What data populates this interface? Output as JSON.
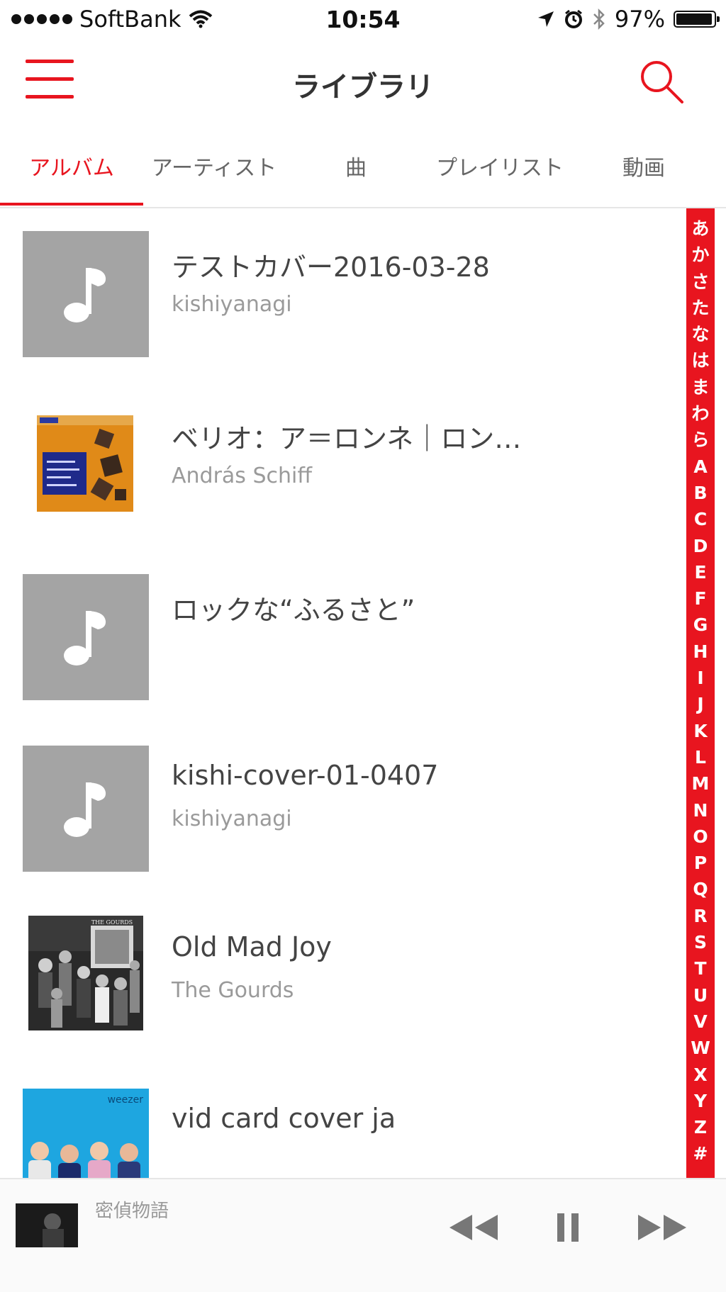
{
  "status_bar": {
    "carrier": "SoftBank",
    "time": "10:54",
    "battery": "97%",
    "battery_level": 0.97,
    "icons": [
      "signal-dots-icon",
      "wifi-icon",
      "location-icon",
      "alarm-icon",
      "bluetooth-icon",
      "battery-icon"
    ]
  },
  "header": {
    "title": "ライブラリ",
    "menu_icon": "hamburger-menu-icon",
    "search_icon": "search-icon",
    "accent": "#e8151f"
  },
  "tabs": [
    {
      "label": "アルバム",
      "active": true
    },
    {
      "label": "アーティスト",
      "active": false
    },
    {
      "label": "曲",
      "active": false
    },
    {
      "label": "プレイリスト",
      "active": false
    },
    {
      "label": "動画",
      "active": false
    }
  ],
  "albums": [
    {
      "title": "テストカバー2016-03-28",
      "artist": "kishiyanagi",
      "cover": "music-note-placeholder"
    },
    {
      "title": "ベリオ：ア＝ロンネ｜ロン…",
      "artist": "András Schiff",
      "cover": "orange-album-art"
    },
    {
      "title": "ロックな“ふるさと”",
      "artist": "",
      "cover": "music-note-placeholder"
    },
    {
      "title": "kishi-cover-01-0407",
      "artist": "kishiyanagi",
      "cover": "music-note-placeholder"
    },
    {
      "title": "Old Mad Joy",
      "artist": "The Gourds",
      "cover": "bw-photo-album-art",
      "cover_text": "THE GOURDS"
    },
    {
      "title": "vid card cover ja",
      "artist": "",
      "cover": "blue-band-photo-album-art",
      "cover_text": "weezer"
    }
  ],
  "index": [
    "あ",
    "か",
    "さ",
    "た",
    "な",
    "は",
    "ま",
    "わ",
    "ら",
    "A",
    "B",
    "C",
    "D",
    "E",
    "F",
    "G",
    "H",
    "I",
    "J",
    "K",
    "L",
    "M",
    "N",
    "O",
    "P",
    "Q",
    "R",
    "S",
    "T",
    "U",
    "V",
    "W",
    "X",
    "Y",
    "Z",
    "#"
  ],
  "now_playing": {
    "title": "密偵物語",
    "controls": [
      "rewind-icon",
      "pause-icon",
      "fast-forward-icon"
    ]
  }
}
